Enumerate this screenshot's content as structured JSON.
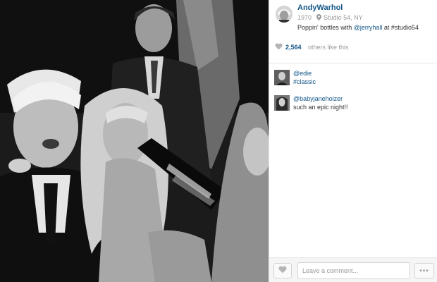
{
  "post": {
    "username": "AndyWarhol",
    "year": "1970",
    "location": "Studio 54, NY",
    "caption_prefix": "Poppin' bottles with ",
    "caption_mention": "@jerryhall",
    "caption_suffix": " at #studio54"
  },
  "likes": {
    "count": "2,564",
    "suffix": "others like this"
  },
  "comments": [
    {
      "user": "@edie",
      "text": "#classic",
      "text_is_tag": true
    },
    {
      "user": "@babyjanehoizer",
      "text": "such an epic night!!",
      "text_is_tag": false
    }
  ],
  "footer": {
    "comment_placeholder": "Leave a comment...",
    "more_label": "•••"
  },
  "colors": {
    "link": "#125688",
    "muted": "#999999",
    "divider": "#e6e6e6"
  },
  "icons": [
    "location-pin-icon",
    "heart-icon",
    "more-dots-icon"
  ]
}
